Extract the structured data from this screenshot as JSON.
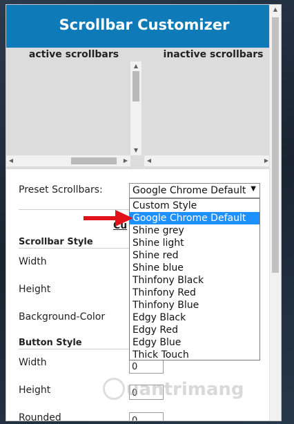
{
  "header": {
    "title": "Scrollbar Customizer"
  },
  "preview": {
    "active_title": "active scrollbars",
    "inactive_title": "inactive scrollbars"
  },
  "preset": {
    "label": "Preset Scrollbars:",
    "selected": "Google Chrome Default",
    "options": [
      "Custom Style",
      "Google Chrome Default",
      "Shine grey",
      "Shine light",
      "Shine red",
      "Shine blue",
      "Thinfony Black",
      "Thinfony Red",
      "Thinfony Blue",
      "Edgy Black",
      "Edgy Red",
      "Edgy Blue",
      "Thick Touch"
    ],
    "highlighted_option": "Google Chrome Default"
  },
  "partial_link": "Cu",
  "scrollbar_style": {
    "heading": "Scrollbar Style",
    "width_label": "Width",
    "height_label": "Height",
    "bg_color_label": "Background-Color"
  },
  "button_style": {
    "heading": "Button Style",
    "width_label": "Width",
    "width_value": "0",
    "height_label": "Height",
    "height_value": "0",
    "rounded_label": "Rounded",
    "rounded_value": "0"
  },
  "watermark": {
    "text": "uantrimang"
  },
  "colors": {
    "header_bg": "#0f7ab8",
    "selected_option_bg": "#1e90ff",
    "arrow": "#e0131b"
  },
  "icons": {
    "select_caret": "▼",
    "arrow_up": "▲",
    "arrow_down": "▼",
    "arrow_left": "◀",
    "arrow_right": "▶"
  }
}
